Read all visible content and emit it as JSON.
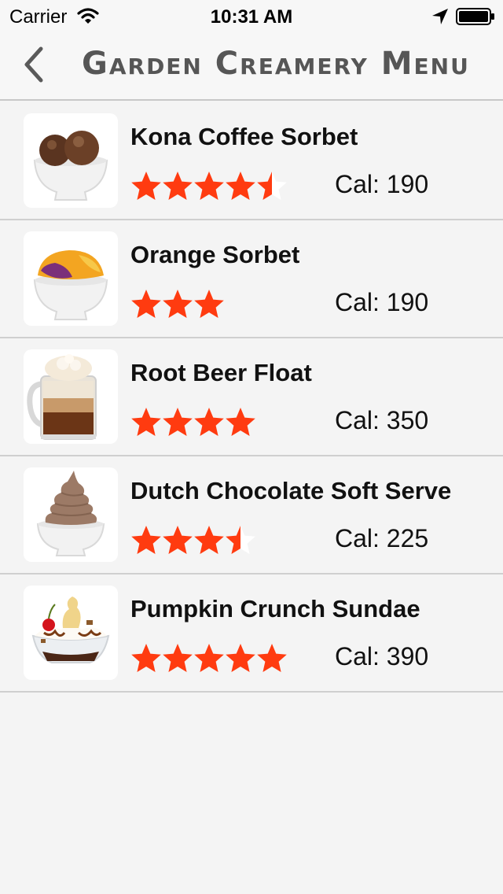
{
  "status_bar": {
    "carrier": "Carrier",
    "time": "10:31 AM"
  },
  "nav": {
    "title": "Garden Creamery Menu",
    "back_icon": "chevron-left-icon"
  },
  "colors": {
    "star": "#ff3b10",
    "nav_title": "#565656"
  },
  "items": [
    {
      "name": "Kona Coffee Sorbet",
      "rating": 4.5,
      "max_rating": 5,
      "calories": "Cal: 190",
      "image": "coffee-sorbet-image"
    },
    {
      "name": "Orange Sorbet",
      "rating": 3,
      "max_rating": 5,
      "calories": "Cal: 190",
      "image": "orange-sorbet-image"
    },
    {
      "name": "Root Beer Float",
      "rating": 4,
      "max_rating": 5,
      "calories": "Cal: 350",
      "image": "root-beer-float-image"
    },
    {
      "name": "Dutch Chocolate Soft Serve",
      "rating": 3.5,
      "max_rating": 5,
      "calories": "Cal: 225",
      "image": "soft-serve-image"
    },
    {
      "name": "Pumpkin Crunch Sundae",
      "rating": 5,
      "max_rating": 5,
      "calories": "Cal: 390",
      "image": "sundae-image"
    }
  ]
}
